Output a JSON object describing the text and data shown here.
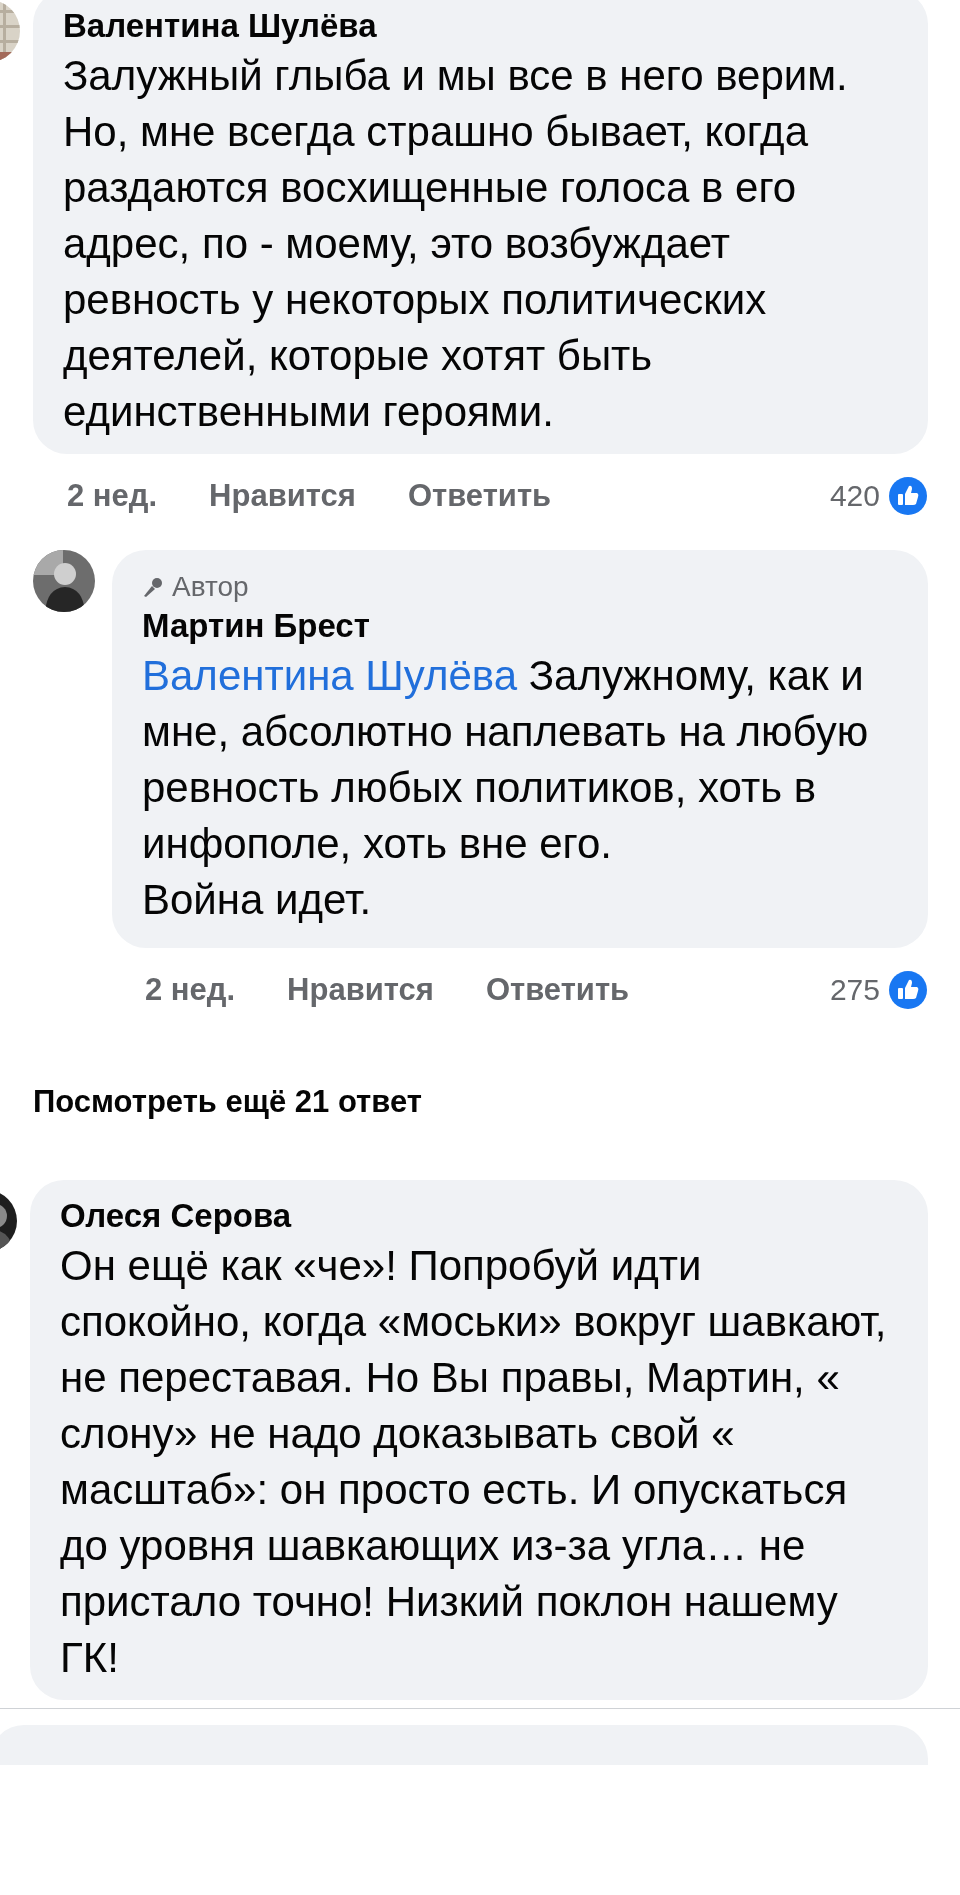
{
  "comments": [
    {
      "author": "Валентина Шулёва",
      "text": "Залужный глыба и мы все в него верим. Но, мне всегда страшно бывает, когда раздаются восхищенные голоса в его адрес, по - моему, это возбуждает ревность у некоторых политических деятелей, которые хотят быть единственными героями.",
      "time": "2 нед.",
      "like_label": "Нравится",
      "reply_label": "Ответить",
      "likes": "420",
      "replies": [
        {
          "badge": "Автор",
          "author": "Мартин Брест",
          "mention": "Валентина Шулёва",
          "text": " Залужному, как и мне, абсолютно наплевать на любую ревность любых политиков, хоть в инфополе, хоть вне его.\nВойна идет.",
          "time": "2 нед.",
          "like_label": "Нравится",
          "reply_label": "Ответить",
          "likes": "275"
        }
      ],
      "more_replies": "Посмотреть ещё 21 ответ"
    },
    {
      "author": "Олеся Серова",
      "text": "Он ещё как «че»! Попробуй идти спокойно, когда «моськи» вокруг шавкают, не переставая. Но Вы правы, Мартин, « слону» не надо доказывать свой « масштаб»: он просто есть. И опускаться до уровня шавкающих из-за угла… не пристало точно! Низкий поклон нашему ГК!"
    }
  ]
}
